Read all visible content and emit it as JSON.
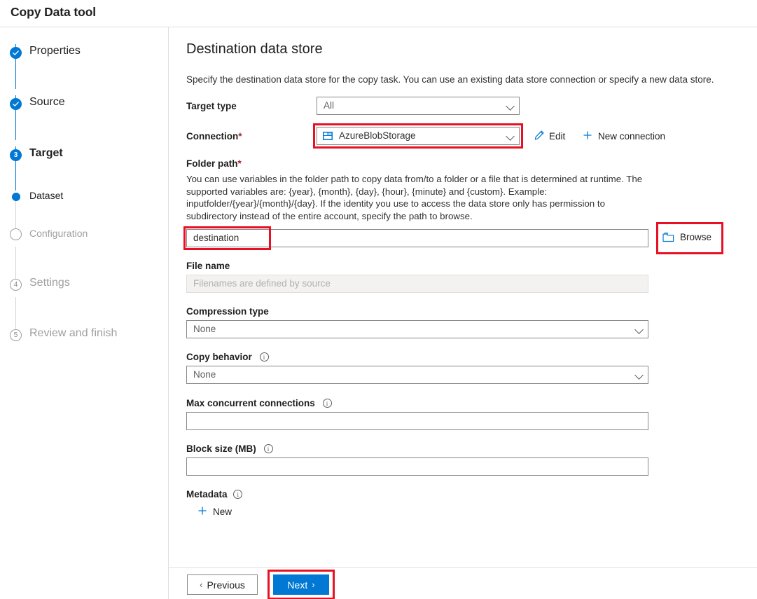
{
  "window": {
    "title": "Copy Data tool"
  },
  "sidebar": {
    "steps": [
      {
        "marker": "check",
        "label": "Properties",
        "state": "done"
      },
      {
        "marker": "check",
        "label": "Source",
        "state": "done"
      },
      {
        "marker": "3",
        "label": "Target",
        "state": "current"
      },
      {
        "marker": "dot",
        "label": "Dataset",
        "state": "sub"
      },
      {
        "marker": "circle",
        "label": "Configuration",
        "state": "disabled"
      },
      {
        "marker": "4",
        "label": "Settings",
        "state": "pending"
      },
      {
        "marker": "5",
        "label": "Review and finish",
        "state": "pending"
      }
    ]
  },
  "main": {
    "title": "Destination data store",
    "description": "Specify the destination data store for the copy task. You can use an existing data store connection or specify a new data store.",
    "target_type": {
      "label": "Target type",
      "value": "All"
    },
    "connection": {
      "label": "Connection",
      "required": "*",
      "value": "AzureBlobStorage",
      "icon": "blob-storage-icon",
      "edit_label": "Edit",
      "edit_icon": "pencil-icon",
      "new_label": "New connection",
      "new_icon": "plus-icon"
    },
    "folder_path": {
      "label": "Folder path",
      "required": "*",
      "help": "You can use variables in the folder path to copy data from/to a folder or a file that is determined at runtime. The supported variables are: {year}, {month}, {day}, {hour}, {minute} and {custom}. Example: inputfolder/{year}/{month}/{day}. If the identity you use to access the data store only has permission to subdirectory instead of the entire account, specify the path to browse.",
      "value": "destination",
      "browse_label": "Browse",
      "browse_icon": "folder-icon"
    },
    "file_name": {
      "label": "File name",
      "placeholder": "Filenames are defined by source",
      "value": ""
    },
    "compression_type": {
      "label": "Compression type",
      "value": "None"
    },
    "copy_behavior": {
      "label": "Copy behavior",
      "info": "info-icon",
      "value": "None"
    },
    "max_concurrent_connections": {
      "label": "Max concurrent connections",
      "info": "info-icon",
      "value": ""
    },
    "block_size": {
      "label": "Block size (MB)",
      "info": "info-icon",
      "value": ""
    },
    "metadata": {
      "label": "Metadata",
      "info": "info-icon",
      "new_label": "New",
      "new_icon": "plus-icon"
    }
  },
  "footer": {
    "previous_label": "Previous",
    "next_label": "Next"
  },
  "colors": {
    "accent": "#0078d4",
    "highlight": "#e81123",
    "required": "#a4262c"
  }
}
